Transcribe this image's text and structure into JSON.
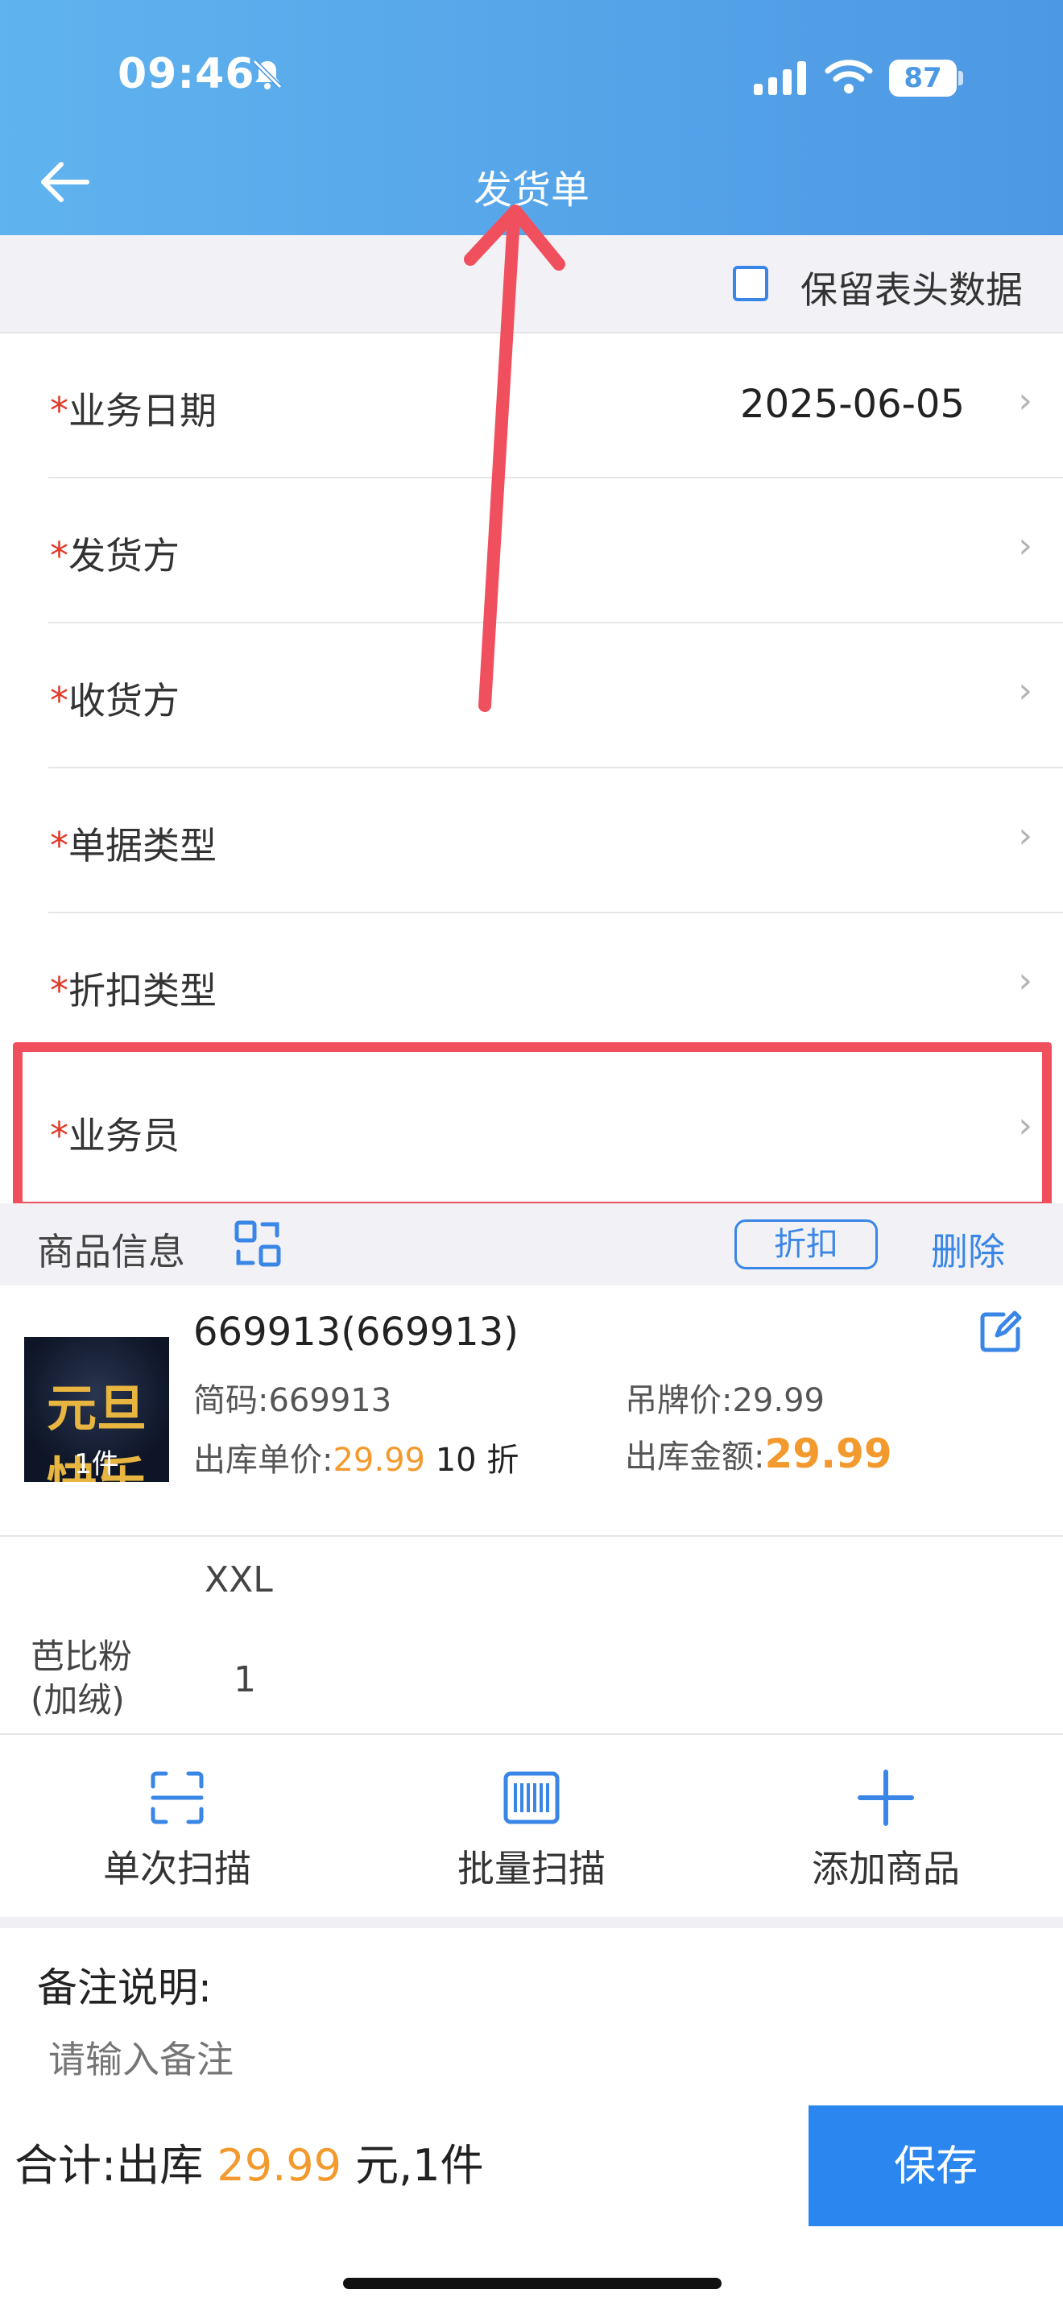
{
  "status_bar": {
    "time": "09:46",
    "battery": "87"
  },
  "header": {
    "title": "发货单"
  },
  "keep_header": {
    "label": "保留表头数据"
  },
  "form": {
    "required_mark": "*",
    "rows": [
      {
        "label": "业务日期",
        "value": "2025-06-05"
      },
      {
        "label": "发货方",
        "value": ""
      },
      {
        "label": "收货方",
        "value": ""
      },
      {
        "label": "单据类型",
        "value": ""
      },
      {
        "label": "折扣类型",
        "value": ""
      },
      {
        "label": "业务员",
        "value": ""
      }
    ]
  },
  "goods": {
    "section_title": "商品信息",
    "discount_button": "折扣",
    "delete_link": "删除",
    "product": {
      "thumb_text": "元旦快乐",
      "thumb_qty": "1件",
      "name": "669913(669913)",
      "code_label": "简码:",
      "code_value": "669913",
      "tag_price_label": "吊牌价:",
      "tag_price_value": "29.99",
      "unit_price_label": "出库单价:",
      "unit_price_value": "29.99",
      "discount_text": "10 折",
      "amount_label": "出库金额:",
      "amount_value": "29.99"
    },
    "size_header": "XXL",
    "color_label_line1": "芭比粉",
    "color_label_line2": "(加绒)",
    "quantity": "1"
  },
  "actions": {
    "single_scan": "单次扫描",
    "batch_scan": "批量扫描",
    "add_goods": "添加商品"
  },
  "remark": {
    "label": "备注说明:",
    "placeholder": "请输入备注"
  },
  "footer": {
    "total_prefix": "合计:出库 ",
    "total_amount": "29.99",
    "total_suffix": " 元,1件",
    "save_label": "保存"
  },
  "colors": {
    "header_blue": "#4d98e4",
    "accent_blue": "#2b87ef",
    "price_orange": "#f39a2e",
    "required_red": "#e23a2a",
    "annotation_red": "#f0505e"
  }
}
